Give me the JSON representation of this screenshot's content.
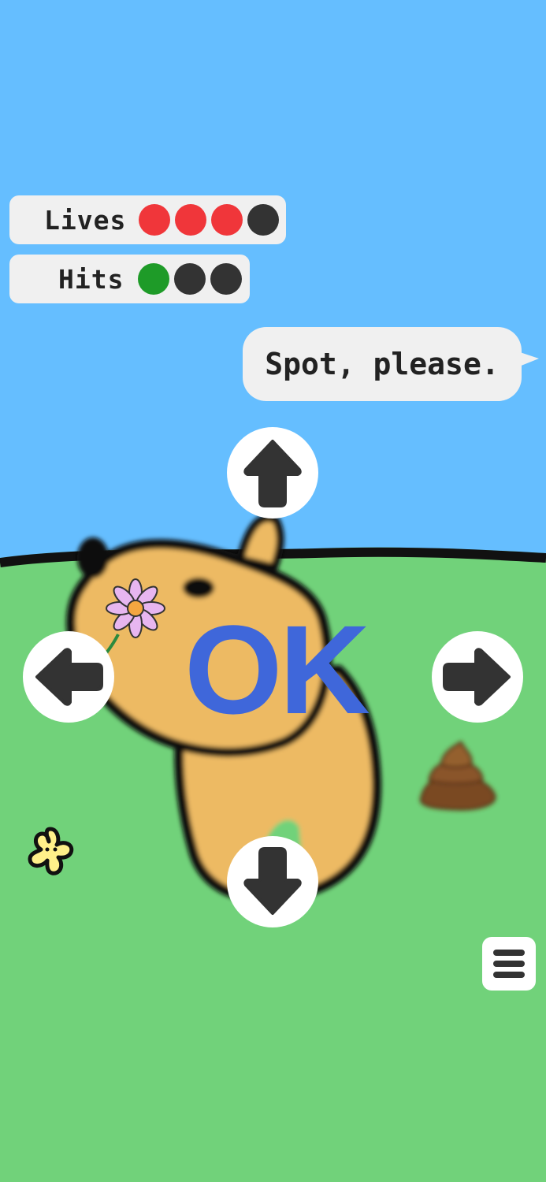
{
  "hud": {
    "lives": {
      "label": "Lives",
      "filled": 3,
      "total": 4,
      "filled_color": "#F0363A",
      "empty_color": "#333333"
    },
    "hits": {
      "label": "Hits",
      "filled": 1,
      "total": 3,
      "filled_color": "#1E9B28",
      "empty_color": "#333333"
    }
  },
  "speech_bubble": {
    "text": "Spot, please."
  },
  "feedback": {
    "text": "OK",
    "color": "#3F67DA"
  },
  "controls": {
    "up": "arrow-up-icon",
    "down": "arrow-down-icon",
    "left": "arrow-left-icon",
    "right": "arrow-right-icon",
    "menu": "menu-icon"
  },
  "colors": {
    "sky": "#65BEFF",
    "grass": "#71D27A",
    "dog": "#EDBA63",
    "button": "#FFFFFF",
    "icon": "#333333"
  }
}
